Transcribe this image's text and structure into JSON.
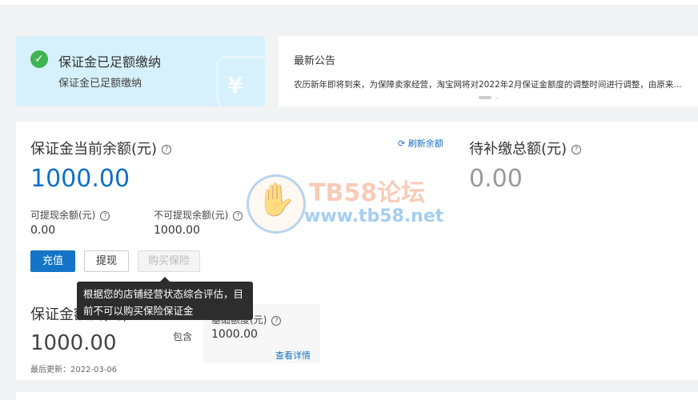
{
  "status": {
    "title": "保证金已足额缴纳",
    "subtitle": "保证金已足额缴纳",
    "shield_glyph": "¥"
  },
  "notice": {
    "title": "最新公告",
    "text": "农历新年即将到来，为保障卖家经营，淘宝网将对2022年2月保证金额度的调整时间进行调整，由原来..."
  },
  "balance": {
    "title": "保证金当前余额(元)",
    "refresh": "刷新余额",
    "amount": "1000.00",
    "withdrawable_label": "可提现余额(元)",
    "withdrawable_value": "0.00",
    "nonwithdrawable_label": "不可提现余额(元)",
    "nonwithdrawable_value": "1000.00"
  },
  "buttons": {
    "recharge": "充值",
    "withdraw": "提现",
    "insurance": "购买保险"
  },
  "pending": {
    "title": "待补缴总额(元)",
    "amount": "0.00"
  },
  "quota": {
    "title": "保证金额度(元)",
    "amount": "1000.00",
    "updated": "最后更新：2022-03-06",
    "contains": "包含",
    "base_label": "基础额度(元)",
    "base_value": "1000.00",
    "details": "查看详情"
  },
  "tooltip": {
    "text": "根据您的店铺经营状态综合评估，目前不可以购买保险保证金"
  },
  "watermark": {
    "name": "TB58论坛",
    "url": "www.tb58.net"
  },
  "help_glyph": "?",
  "colors": {
    "accent": "#1474c8",
    "status_bg": "#d6f1fb",
    "success": "#3fb453"
  }
}
